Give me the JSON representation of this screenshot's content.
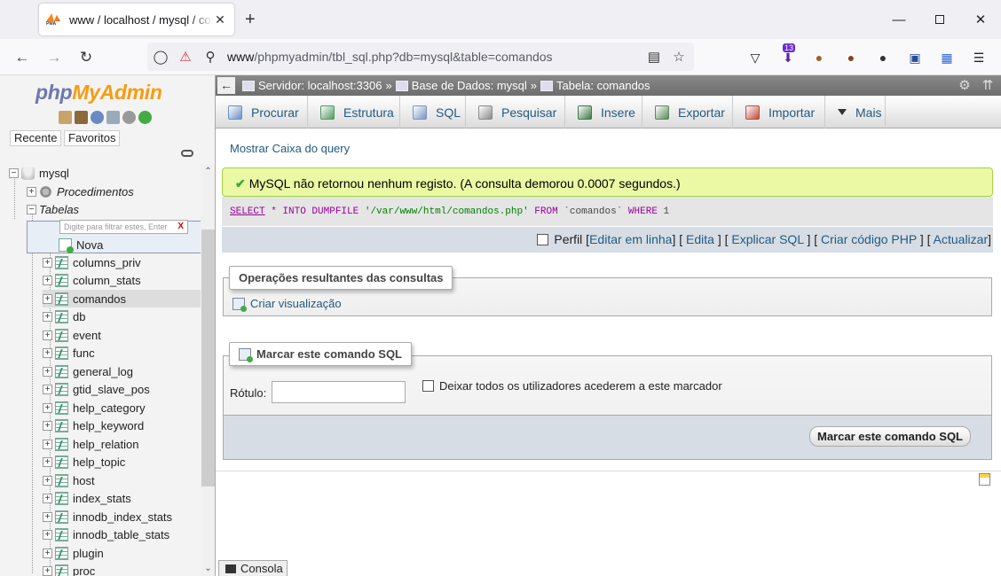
{
  "browser": {
    "tab_title": "www / localhost / mysql / comandos",
    "tab_close": "✕",
    "new_tab": "+",
    "url_path": "www",
    "url_rest": "/phpmyadmin/tbl_sql.php?db=mysql&table=comandos",
    "extension_badge": "13"
  },
  "sidebar": {
    "logo_php": "php",
    "logo_myadmin": "MyAdmin",
    "recent_label": "Recente",
    "favorites_label": "Favoritos",
    "filter_placeholder": "Digite para filtrar estes, Enter",
    "filter_clear": "X",
    "tree": {
      "db_name": "mysql",
      "procedures_label": "Procedimentos",
      "tables_label": "Tabelas",
      "new_label": "Nova",
      "tables": [
        "columns_priv",
        "column_stats",
        "comandos",
        "db",
        "event",
        "func",
        "general_log",
        "gtid_slave_pos",
        "help_category",
        "help_keyword",
        "help_relation",
        "help_topic",
        "host",
        "index_stats",
        "innodb_index_stats",
        "innodb_table_stats",
        "plugin",
        "proc"
      ],
      "selected_table": "comandos"
    }
  },
  "breadcrumb": {
    "server": "Servidor: localhost:3306",
    "database": "Base de Dados: mysql",
    "table": "Tabela: comandos",
    "separator": "»"
  },
  "tabs": [
    {
      "label": "Procurar",
      "icon": "browse-icon",
      "color": "#6a8fc4"
    },
    {
      "label": "Estrutura",
      "icon": "structure-icon",
      "color": "#4f9a62"
    },
    {
      "label": "SQL",
      "icon": "sql-icon",
      "color": "#7a94c2"
    },
    {
      "label": "Pesquisar",
      "icon": "search-icon",
      "color": "#8a8a8a"
    },
    {
      "label": "Insere",
      "icon": "insert-icon",
      "color": "#3a7a46"
    },
    {
      "label": "Exportar",
      "icon": "export-icon",
      "color": "#5a8a5a"
    },
    {
      "label": "Importar",
      "icon": "import-icon",
      "color": "#c04a3a"
    },
    {
      "label": "Mais",
      "icon": "chevron-down-icon",
      "color": "#333333"
    }
  ],
  "main": {
    "show_query_link": "Mostrar Caixa do query",
    "success_message": "MySQL não retornou nenhum registo. (A consulta demorou 0.0007 segundos.)",
    "sql": {
      "select": "SELECT",
      "star": " * ",
      "into": "INTO DUMPFILE",
      "path": " '/var/www/html/comandos.php' ",
      "from": "FROM",
      "table": " `comandos` ",
      "where": "WHERE",
      "value": " 1"
    },
    "actions": {
      "profile": "Perfil",
      "edit_inline": "Editar em linha",
      "edit": "Edita",
      "explain": "Explicar SQL",
      "create_php": "Criar código PHP",
      "refresh": "Actualizar"
    },
    "query_results_ops": {
      "legend": "Operações resultantes das consultas",
      "create_view": "Criar visualização"
    },
    "bookmark": {
      "legend": "Marcar este comando SQL",
      "label_field": "Rótulo:",
      "label_value": "",
      "share_checkbox": "Deixar todos os utilizadores acederem a este marcador",
      "submit": "Marcar este comando SQL"
    },
    "console_label": "Consola"
  }
}
